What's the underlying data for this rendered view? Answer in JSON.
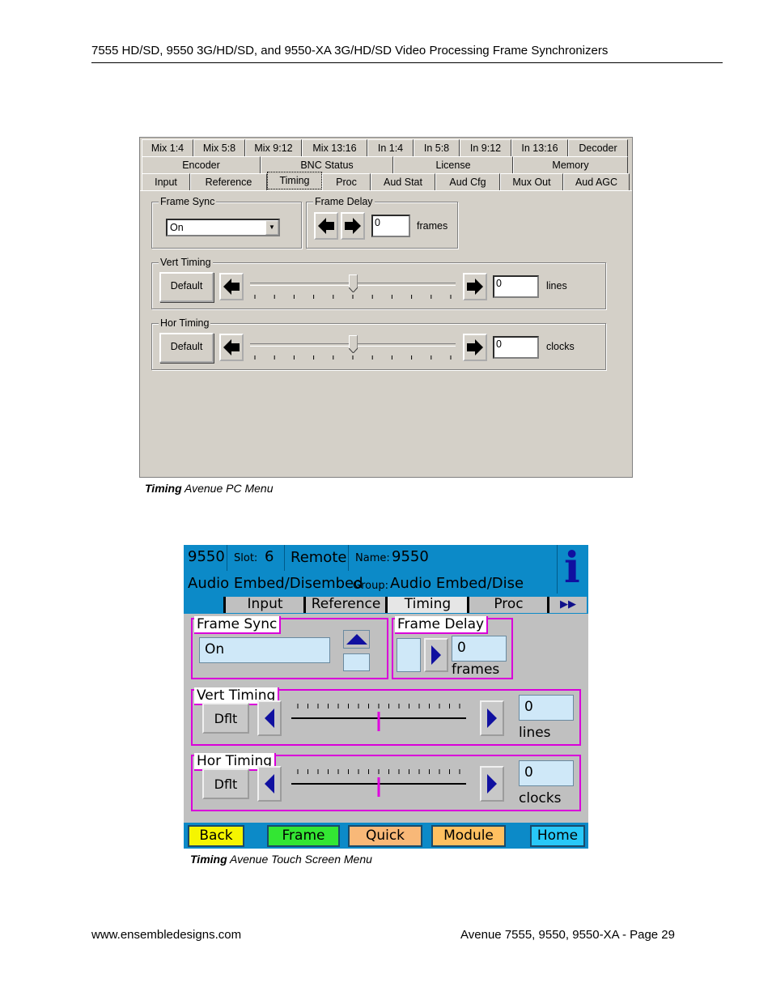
{
  "page": {
    "header": "7555 HD/SD, 9550 3G/HD/SD, and 9550-XA 3G/HD/SD Video Processing Frame Synchronizers",
    "footer_left": "www.ensembledesigns.com",
    "footer_right": "Avenue 7555, 9550, 9550-XA - Page 29"
  },
  "pc_menu": {
    "caption_bold": "Timing",
    "caption_rest": " Avenue PC Menu",
    "tabs_row1": [
      "Mix 1:4",
      "Mix 5:8",
      "Mix 9:12",
      "Mix 13:16",
      "In 1:4",
      "In 5:8",
      "In 9:12",
      "In 13:16",
      "Decoder"
    ],
    "tabs_row2": [
      "Encoder",
      "BNC Status",
      "License",
      "Memory"
    ],
    "tabs_row3": [
      "Input",
      "Reference",
      "Timing",
      "Proc",
      "Aud Stat",
      "Aud Cfg",
      "Mux Out",
      "Aud AGC"
    ],
    "active_tab": "Timing",
    "frame_sync": {
      "label": "Frame Sync",
      "value": "On"
    },
    "frame_delay": {
      "label": "Frame Delay",
      "value": "0",
      "unit": "frames"
    },
    "vert_timing": {
      "label": "Vert Timing",
      "default_label": "Default",
      "value": "0",
      "unit": "lines",
      "slider_fraction": 0.5
    },
    "hor_timing": {
      "label": "Hor Timing",
      "default_label": "Default",
      "value": "0",
      "unit": "clocks",
      "slider_fraction": 0.5
    }
  },
  "touch_menu": {
    "caption_bold": "Timing",
    "caption_rest": " Avenue Touch Screen Menu",
    "model": "9550",
    "slot_label": "Slot:",
    "slot_value": "6",
    "remote": "Remote",
    "name_label": "Name:",
    "name_value": "9550",
    "module_name": "Audio Embed/Disembed",
    "group_label": "Group:",
    "group_value": "Audio Embed/Dise",
    "info_icon": "i",
    "tabs": [
      "Input",
      "Reference",
      "Timing",
      "Proc"
    ],
    "more_tabs": "▶▶",
    "active_tab": "Timing",
    "frame_sync": {
      "label": "Frame Sync",
      "value": "On"
    },
    "frame_delay": {
      "label": "Frame Delay",
      "value": "0",
      "unit": "frames"
    },
    "vert_timing": {
      "label": "Vert Timing",
      "default_label": "Dflt",
      "value": "0",
      "unit": "lines",
      "slider_fraction": 0.5
    },
    "hor_timing": {
      "label": "Hor Timing",
      "default_label": "Dflt",
      "value": "0",
      "unit": "clocks",
      "slider_fraction": 0.5
    },
    "nav": [
      {
        "label": "Back",
        "color": "#f5f500"
      },
      {
        "label": "Frame",
        "color": "#33e633"
      },
      {
        "label": "Quick",
        "color": "#f8b878"
      },
      {
        "label": "Module",
        "color": "#ffc060"
      },
      {
        "label": "Home",
        "color": "#28c8f8"
      }
    ]
  }
}
